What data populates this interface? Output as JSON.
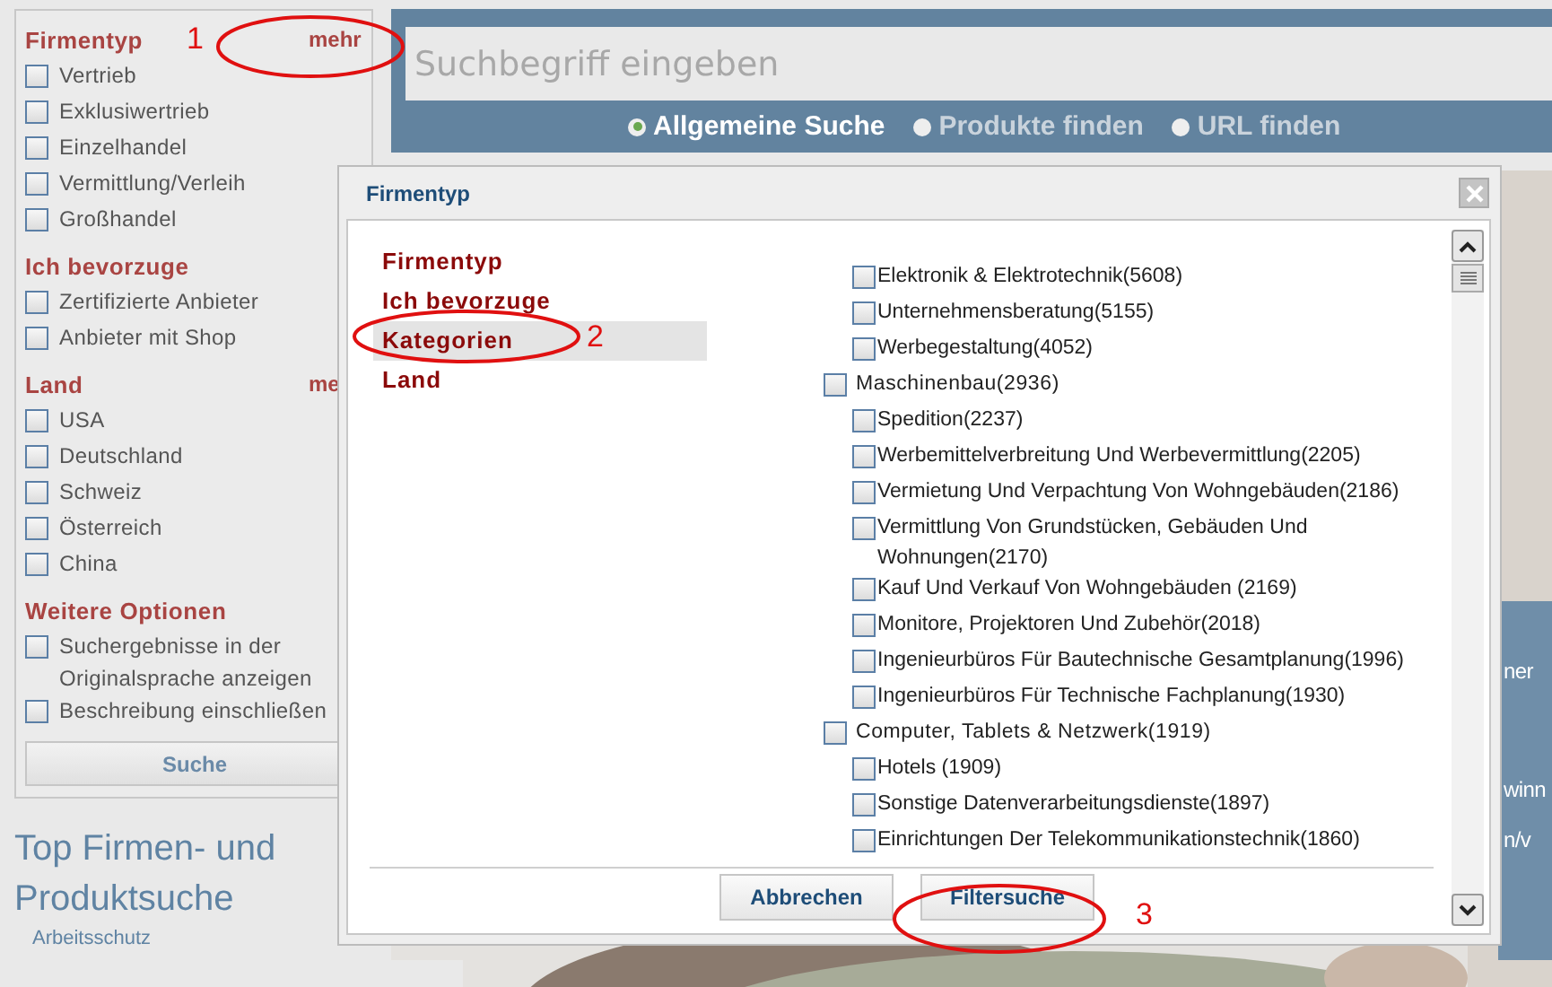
{
  "sidebar": {
    "sections": [
      {
        "title": "Firmentyp",
        "more": "mehr",
        "options": [
          {
            "label": "Vertrieb",
            "checked": false
          },
          {
            "label": "Exklusiwertrieb",
            "checked": false
          },
          {
            "label": "Einzelhandel",
            "checked": false
          },
          {
            "label": "Vermittlung/Verleih",
            "checked": false
          },
          {
            "label": "Großhandel",
            "checked": false
          }
        ]
      },
      {
        "title": "Ich bevorzuge",
        "options": [
          {
            "label": "Zertifizierte Anbieter",
            "checked": false
          },
          {
            "label": "Anbieter mit Shop",
            "checked": false
          }
        ]
      },
      {
        "title": "Land",
        "more": "me",
        "options": [
          {
            "label": "USA",
            "checked": false
          },
          {
            "label": "Deutschland",
            "checked": false
          },
          {
            "label": "Schweiz",
            "checked": false
          },
          {
            "label": "Österreich",
            "checked": false
          },
          {
            "label": "China",
            "checked": false
          }
        ]
      },
      {
        "title": "Weitere Optionen",
        "options": [
          {
            "label": "Suchergebnisse in der Originalsprache anzeigen",
            "checked": false
          },
          {
            "label": "Beschreibung einschließen",
            "checked": false
          }
        ]
      }
    ],
    "search_button": "Suche",
    "heading": "Top Firmen- und Produktsuche",
    "links": [
      "Arbeitsschutz"
    ]
  },
  "search": {
    "placeholder": "Suchbegriff eingeben",
    "modes": [
      {
        "label": "Allgemeine Suche",
        "selected": true
      },
      {
        "label": "Produkte finden",
        "selected": false
      },
      {
        "label": "URL finden",
        "selected": false
      }
    ]
  },
  "banner": {
    "kind": "picture",
    "fragments": [
      "ner",
      "winn",
      "n/v"
    ]
  },
  "dialog": {
    "title": "Firmentyp",
    "nav": [
      {
        "label": "Firmentyp",
        "selected": false
      },
      {
        "label": "Ich bevorzuge",
        "selected": false
      },
      {
        "label": "Kategorien",
        "selected": true
      },
      {
        "label": "Land",
        "selected": false
      }
    ],
    "categories": [
      {
        "children": [
          {
            "label": "Elektronik & Elektrotechnik(5608)",
            "checked": false
          },
          {
            "label": "Unternehmensberatung(5155)",
            "checked": false
          },
          {
            "label": "Werbegestaltung(4052)",
            "checked": false
          }
        ]
      },
      {
        "label": "Maschinenbau(2936)",
        "checked": false,
        "children": [
          {
            "label": "Spedition(2237)",
            "checked": false
          },
          {
            "label": "Werbemittelverbreitung Und Werbevermittlung(2205)",
            "checked": false
          },
          {
            "label": "Vermietung Und Verpachtung Von Wohngebäuden(2186)",
            "checked": false
          },
          {
            "label": "Vermittlung Von Grundstücken, Gebäuden Und Wohnungen(2170)",
            "checked": false
          },
          {
            "label": "Kauf Und Verkauf Von Wohngebäuden (2169)",
            "checked": false
          },
          {
            "label": "Monitore, Projektoren Und Zubehör(2018)",
            "checked": false
          },
          {
            "label": "Ingenieurbüros Für Bautechnische Gesamtplanung(1996)",
            "checked": false
          },
          {
            "label": "Ingenieurbüros Für Technische Fachplanung(1930)",
            "checked": false
          }
        ]
      },
      {
        "label": "Computer, Tablets & Netzwerk(1919)",
        "checked": false,
        "children": [
          {
            "label": "Hotels (1909)",
            "checked": false
          },
          {
            "label": "Sonstige Datenverarbeitungsdienste(1897)",
            "checked": false
          },
          {
            "label": "Einrichtungen Der Telekommunikationstechnik(1860)",
            "checked": false
          }
        ]
      }
    ],
    "buttons": [
      "Abbrechen",
      "Filtersuche"
    ]
  },
  "annotations": [
    {
      "label": "1"
    },
    {
      "label": "2"
    },
    {
      "label": "3"
    }
  ]
}
